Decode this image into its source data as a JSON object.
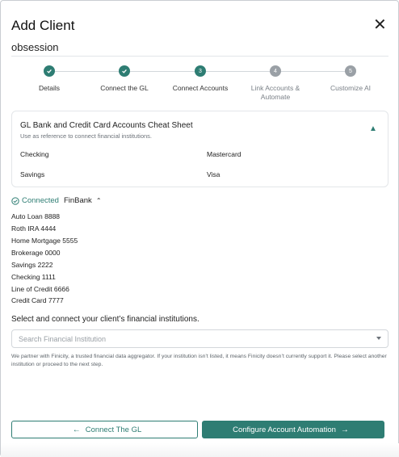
{
  "modal": {
    "title": "Add Client",
    "close_glyph": "✕",
    "client_name": "obsession"
  },
  "steps": [
    {
      "number": "1",
      "label": "Details",
      "status": "done"
    },
    {
      "number": "2",
      "label": "Connect the GL",
      "status": "done"
    },
    {
      "number": "3",
      "label": "Connect Accounts",
      "status": "active"
    },
    {
      "number": "4",
      "label": "Link Accounts & Automate",
      "status": "todo"
    },
    {
      "number": "5",
      "label": "Customize AI",
      "status": "todo"
    }
  ],
  "cheat_sheet": {
    "title": "GL Bank and Credit Card Accounts Cheat Sheet",
    "subtitle": "Use as reference to connect financial institutions.",
    "items": [
      "Checking",
      "Mastercard",
      "Savings",
      "Visa"
    ]
  },
  "connection": {
    "status": "Connected",
    "bank": "FinBank",
    "accounts": [
      "Auto Loan 8888",
      "Roth IRA 4444",
      "Home Mortgage 5555",
      "Brokerage 0000",
      "Savings 2222",
      "Checking 1111",
      "Line of Credit 6666",
      "Credit Card 7777"
    ]
  },
  "institution_search": {
    "label": "Select and connect your client’s financial institutions.",
    "placeholder": "Search Financial Institution",
    "note": "We partner with Finicity, a trusted financial data aggregator. If your institution isn’t listed, it means Finicity doesn’t currently support it. Please select another institution or proceed to the next step."
  },
  "footer": {
    "back_label": "Connect The GL",
    "next_label": "Configure Account Automation"
  },
  "colors": {
    "accent": "#2e7d73",
    "inactive": "#9aa0a6"
  }
}
